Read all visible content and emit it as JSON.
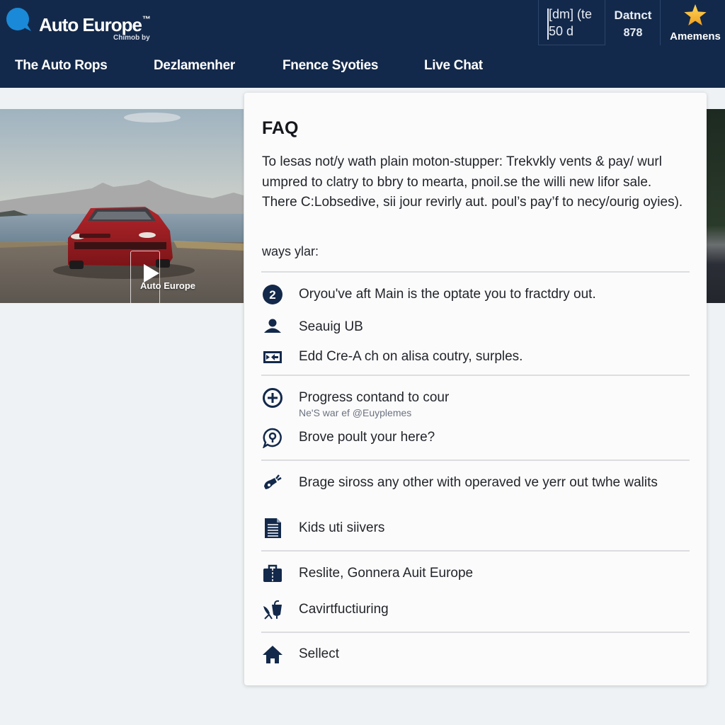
{
  "header": {
    "brand": "Auto Europe",
    "brand_mark": "™",
    "brand_sub": "Chimob by",
    "box_line1": "[dm] (te",
    "box_line2": "50 d",
    "stat_label": "Datnct",
    "stat_value": "878",
    "fav_label": "Amemens",
    "accent": "#13294b",
    "logo_color": "#1a8ad8",
    "star_color": "#f5b731"
  },
  "nav": {
    "items": [
      {
        "label": "The Auto Rops"
      },
      {
        "label": "Dezlamenher"
      },
      {
        "label": "Fnence Syoties"
      },
      {
        "label": "Live Chat"
      }
    ]
  },
  "hero": {
    "video_label": "Auto Europe"
  },
  "faq": {
    "title": "FAQ",
    "intro": "To lesas not/y wath plain moton-stupper: Trekvkly vents & pay/ wurl umpred to clatry to bbry to mearta, pnoil.se the willi new lifor sale. There C:Lobsedive, sii jour revirly aut. poul’s pay’f to necy/ourig oyies).",
    "subheading": "ways ylar:",
    "items": [
      {
        "icon": "number-2-icon",
        "text": "Oryou've aft Main is the optate you to fractdry out."
      },
      {
        "icon": "user-icon",
        "text": "Seauig UB"
      },
      {
        "icon": "forward-arrow-icon",
        "text": "Edd Cre-A ch on alisa coutry, surples."
      },
      {
        "icon": "plus-circle-icon",
        "text": "Progress contand to cour",
        "sub": "Ne'S war ef @Euyplemes"
      },
      {
        "icon": "location-chat-icon",
        "text": "Brove poult your here?"
      },
      {
        "icon": "key-icon",
        "text": "Brage siross any other with operaved ve yerr out twhe walits"
      },
      {
        "icon": "document-icon",
        "text": "Kids uti siivers"
      },
      {
        "icon": "briefcase-icon",
        "text": "Reslite, Gonnera Auit Europe"
      },
      {
        "icon": "bird-cup-icon",
        "text": "Cavirtfuctiuring"
      },
      {
        "icon": "home-icon",
        "text": "Sellect"
      }
    ]
  }
}
